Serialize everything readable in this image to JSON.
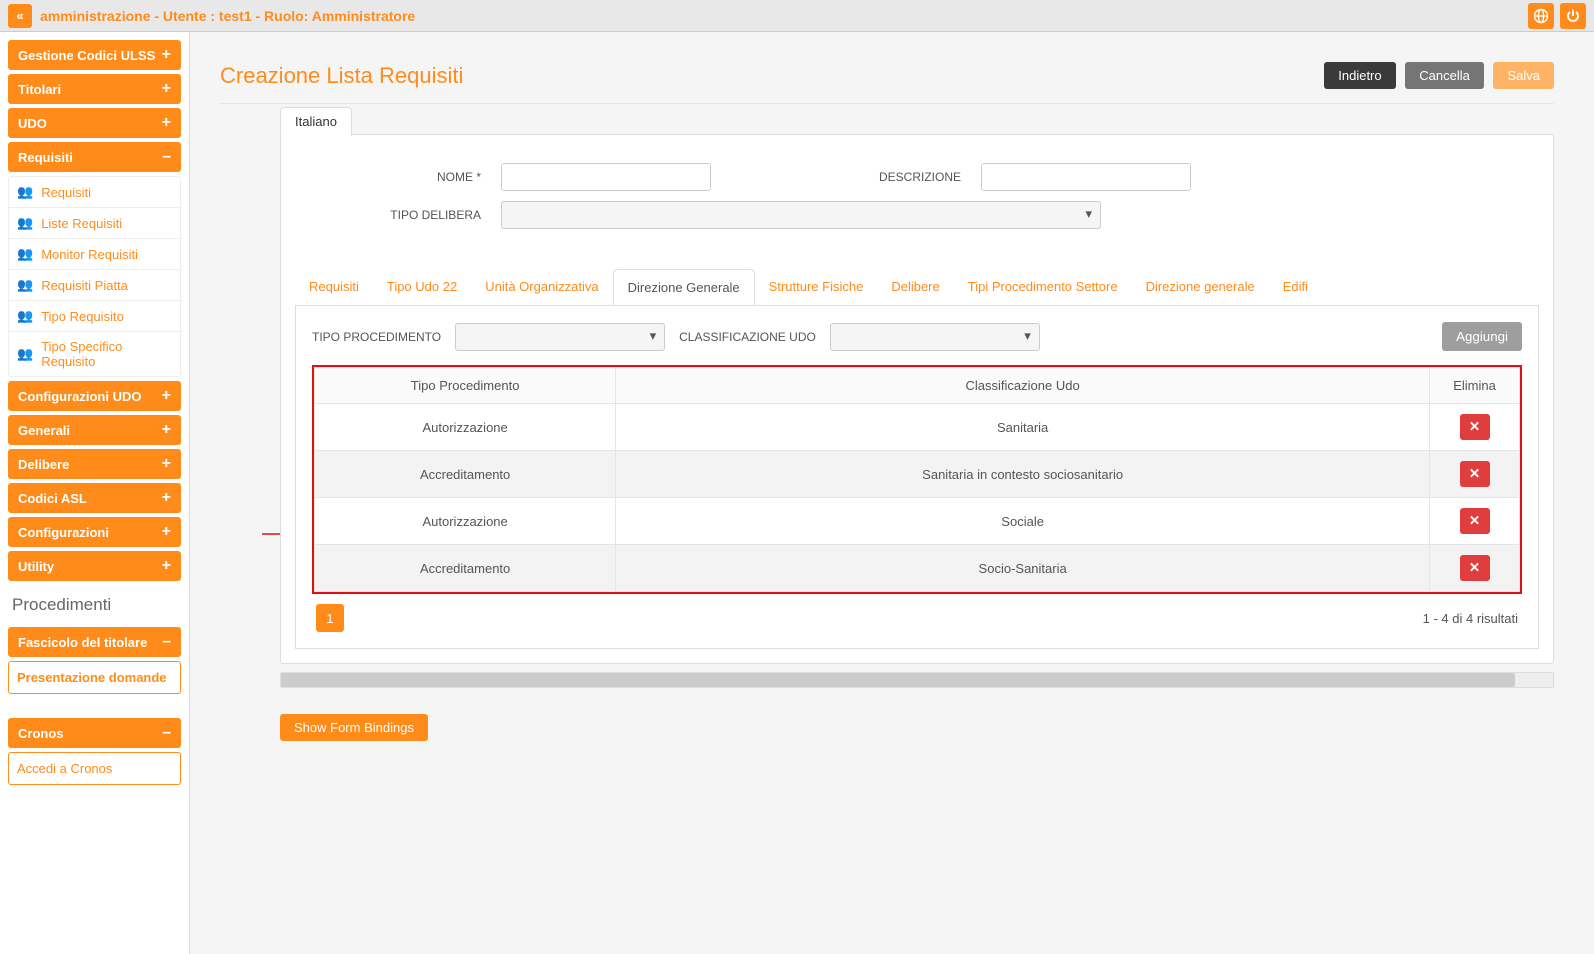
{
  "topbar": {
    "title": "amministrazione - Utente : test1 - Ruolo: Amministratore"
  },
  "sidebar": {
    "panels": [
      {
        "label": "Gestione Codici ULSS",
        "icon": "+"
      },
      {
        "label": "Titolari",
        "icon": "+"
      },
      {
        "label": "UDO",
        "icon": "+"
      }
    ],
    "requisiti": {
      "label": "Requisiti",
      "icon": "–",
      "items": [
        {
          "label": "Requisiti"
        },
        {
          "label": "Liste Requisiti"
        },
        {
          "label": "Monitor Requisiti"
        },
        {
          "label": "Requisiti Piatta"
        },
        {
          "label": "Tipo Requisito"
        },
        {
          "label": "Tipo Specifico Requisito"
        }
      ]
    },
    "panels2": [
      {
        "label": "Configurazioni UDO",
        "icon": "+"
      },
      {
        "label": "Generali",
        "icon": "+"
      },
      {
        "label": "Delibere",
        "icon": "+"
      },
      {
        "label": "Codici ASL",
        "icon": "+"
      },
      {
        "label": "Configurazioni",
        "icon": "+"
      },
      {
        "label": "Utility",
        "icon": "+"
      }
    ],
    "procedimenti_title": "Procedimenti",
    "fascicolo": {
      "label": "Fascicolo del titolare",
      "icon": "–",
      "item": "Presentazione domande"
    },
    "cronos": {
      "label": "Cronos",
      "icon": "–",
      "item": "Accedi a Cronos"
    }
  },
  "page": {
    "title": "Creazione Lista Requisiti",
    "btn_back": "Indietro",
    "btn_cancel": "Cancella",
    "btn_save": "Salva",
    "lang_tab": "Italiano",
    "label_nome": "NOME *",
    "label_descrizione": "DESCRIZIONE",
    "label_tipo_delibera": "TIPO DELIBERA",
    "tabs": [
      "Requisiti",
      "Tipo Udo 22",
      "Unità Organizzativa",
      "Direzione Generale",
      "Strutture Fisiche",
      "Delibere",
      "Tipi Procedimento Settore",
      "Direzione generale",
      "Edifi"
    ],
    "active_tab_index": 3,
    "filter_labels": {
      "tipo_proc": "TIPO PROCEDIMENTO",
      "class_udo": "CLASSIFICAZIONE UDO"
    },
    "btn_add": "Aggiungi",
    "table": {
      "headers": [
        "Tipo Procedimento",
        "Classificazione Udo",
        "Elimina"
      ],
      "rows": [
        {
          "c0": "Autorizzazione",
          "c1": "Sanitaria"
        },
        {
          "c0": "Accreditamento",
          "c1": "Sanitaria in contesto sociosanitario"
        },
        {
          "c0": "Autorizzazione",
          "c1": "Sociale"
        },
        {
          "c0": "Accreditamento",
          "c1": "Socio-Sanitaria"
        }
      ]
    },
    "pager": {
      "page": "1",
      "info": "1 - 4 di 4 risultati"
    },
    "show_bindings": "Show Form Bindings"
  }
}
